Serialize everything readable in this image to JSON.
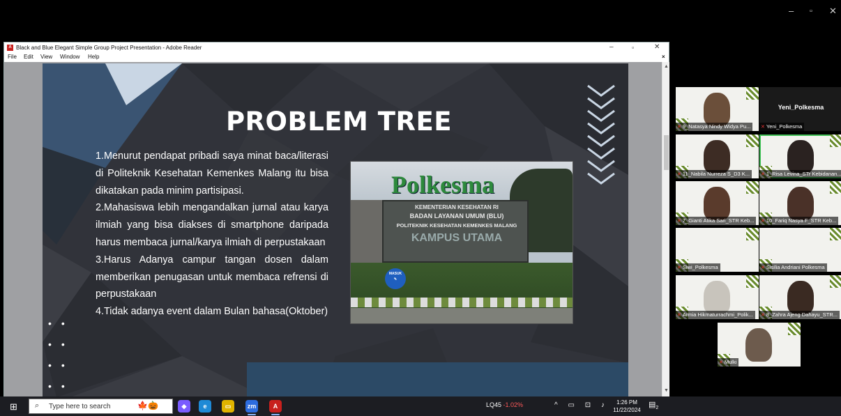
{
  "window_controls": {
    "minimize": "–",
    "maximize": "▫",
    "close": "✕"
  },
  "reader": {
    "title": "Black and Blue Elegant Simple Group Project Presentation - Adobe Reader",
    "menu": [
      "File",
      "Edit",
      "View",
      "Window",
      "Help"
    ],
    "close_doc": "×"
  },
  "slide": {
    "title": "PROBLEM TREE",
    "points": [
      "1.Menurut pendapat pribadi saya minat baca/literasi di Politeknik Kesehatan Kemenkes Malang itu bisa dikatakan pada minim partisipasi.",
      "2.Mahasiswa lebih mengandalkan jurnal atau karya ilmiah yang bisa diakses di smartphone daripada harus membaca jurnal/karya ilmiah di perpustakaan",
      "3.Harus Adanya campur tangan dosen dalam memberikan penugasan untuk membaca refrensi di perpustakaan",
      "4.Tidak adanya event dalam Bulan bahasa(Oktober)"
    ],
    "photo": {
      "logo": "Polkesma",
      "sign_lines": [
        "KEMENTERIAN KESEHATAN RI",
        "BADAN LAYANAN UMUM (BLU)",
        "POLITEKNIK KESEHATAN KEMENKES MALANG",
        "KAMPUS UTAMA"
      ],
      "masuk_label": "MASUK"
    }
  },
  "participants": [
    {
      "name": "9_Natasya Nindy Widya Pu...",
      "face": "#6b4f3a",
      "dark": false
    },
    {
      "name": "Yeni_Polkesma",
      "face": "",
      "dark": true
    },
    {
      "name": "11_Nabila Nurreza S_D3 K...",
      "face": "#3d2c24",
      "dark": false
    },
    {
      "name": "1_Risa Levina_STr Kebidanan...",
      "face": "#2a2220",
      "dark": false,
      "highlight": true
    },
    {
      "name": "7_Gianti Atika Sari_STR Keb...",
      "face": "#5a3b2c",
      "dark": false
    },
    {
      "name": "10_Fariq Nasya F_STR Keb...",
      "face": "#4a3128",
      "dark": false
    },
    {
      "name": "Siwi_Polkesma",
      "face": "",
      "dark": false
    },
    {
      "name": "Sisilia Andriani Polkesma",
      "face": "",
      "dark": false
    },
    {
      "name": "Armia Hikmaturrachmi_Polik...",
      "face": "#c8c4bc",
      "dark": false
    },
    {
      "name": "8_Zahra Ajeng Dahayu_STR...",
      "face": "#3a2a22",
      "dark": false
    },
    {
      "name": "Mulki",
      "face": "#6d5b4d",
      "dark": false
    }
  ],
  "taskbar": {
    "search_placeholder": "Type here to search",
    "stock_symbol": "LQ45",
    "stock_change": "-1.02%",
    "time": "1:26 PM",
    "date": "11/22/2024",
    "notification_count": "2",
    "apps": [
      {
        "name": "copilot-icon",
        "label": "◆",
        "color": "#7a5cff"
      },
      {
        "name": "edge-icon",
        "label": "e",
        "color": "#1f8ad6"
      },
      {
        "name": "file-explorer-icon",
        "label": "▭",
        "color": "#e0b400"
      },
      {
        "name": "zoom-icon",
        "label": "zm",
        "color": "#2d6cdf"
      },
      {
        "name": "adobe-reader-icon",
        "label": "A",
        "color": "#c8201d"
      }
    ]
  }
}
